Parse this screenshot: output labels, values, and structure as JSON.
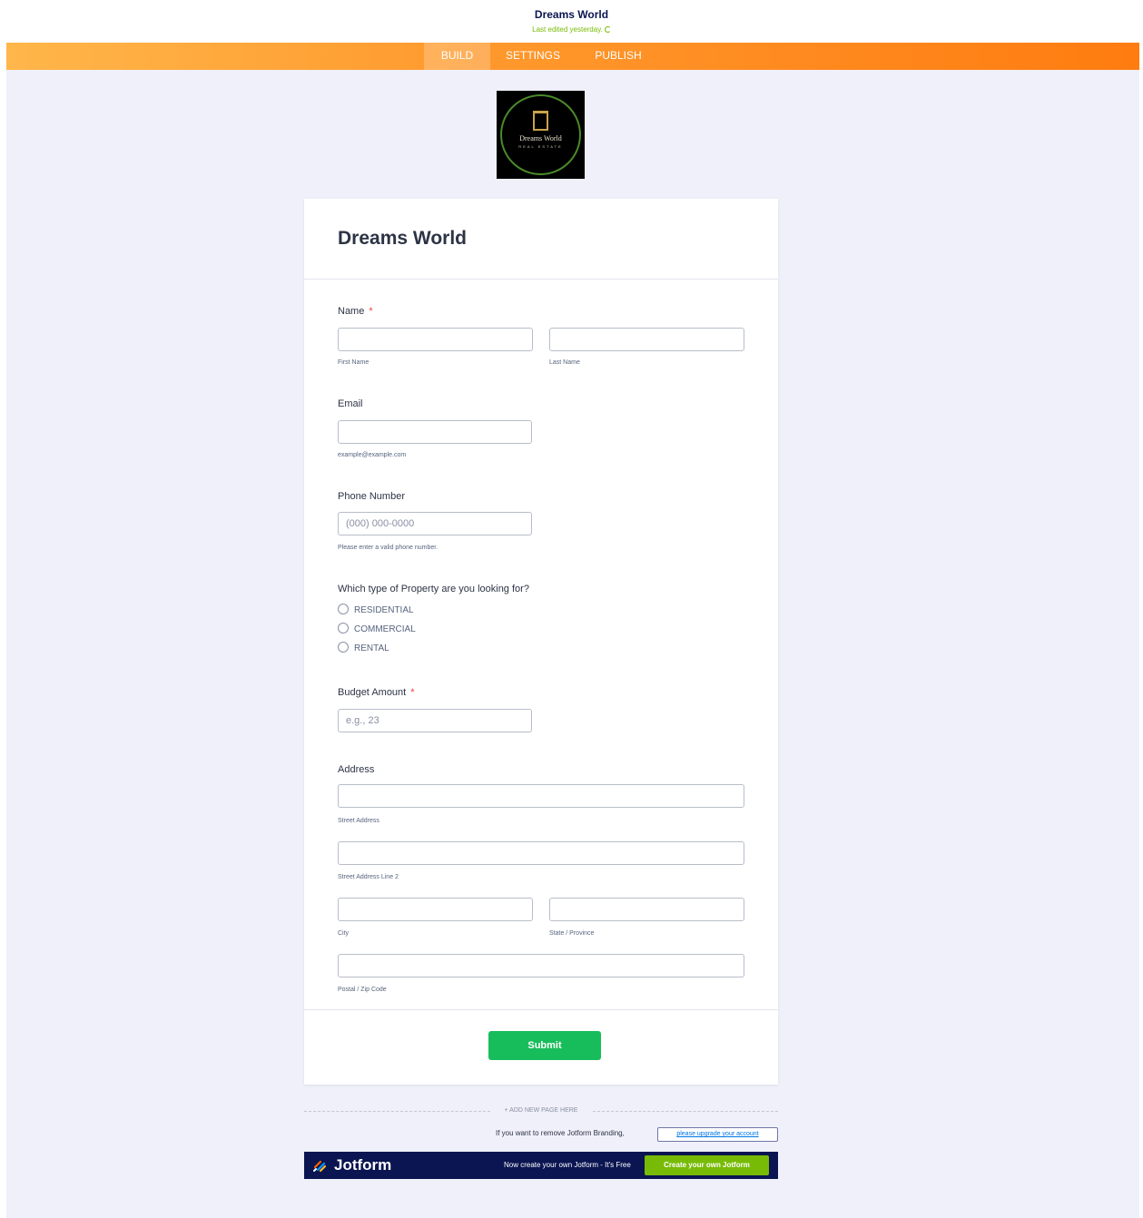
{
  "header": {
    "title": "Dreams World",
    "last_edited": "Last edited yesterday."
  },
  "nav": {
    "tabs": [
      {
        "label": "BUILD",
        "active": true
      },
      {
        "label": "SETTINGS",
        "active": false
      },
      {
        "label": "PUBLISH",
        "active": false
      }
    ]
  },
  "logo": {
    "text": "Dreams World",
    "subtext": "REAL ESTATE"
  },
  "form": {
    "title": "Dreams World",
    "name": {
      "label": "Name",
      "required_mark": "*",
      "first_sublabel": "First Name",
      "last_sublabel": "Last Name"
    },
    "email": {
      "label": "Email",
      "sublabel": "example@example.com"
    },
    "phone": {
      "label": "Phone Number",
      "placeholder": "(000) 000-0000",
      "sublabel": "Please enter a valid phone number."
    },
    "property": {
      "label": "Which type of Property are you looking for?",
      "options": [
        "RESIDENTIAL",
        "COMMERCIAL",
        "RENTAL"
      ]
    },
    "budget": {
      "label": "Budget Amount",
      "required_mark": "*",
      "placeholder": "e.g., 23"
    },
    "address": {
      "label": "Address",
      "street_sublabel": "Street Address",
      "street2_sublabel": "Street Address Line 2",
      "city_sublabel": "City",
      "state_sublabel": "State / Province",
      "zip_sublabel": "Postal / Zip Code"
    },
    "submit_label": "Submit"
  },
  "add_page": "+ ADD NEW PAGE HERE",
  "branding": {
    "text": "If you want to remove Jotform Branding,",
    "link": "please upgrade your account"
  },
  "jotform_bar": {
    "logo": "Jotform",
    "tagline": "Now create your own Jotform - It's Free",
    "cta": "Create your own Jotform"
  },
  "colors": {
    "nav_orange": "#ff8a1f",
    "submit_green": "#18bd5b",
    "cta_green": "#78bb07",
    "jotform_navy": "#0a1551",
    "required_red": "#f23a3c"
  }
}
